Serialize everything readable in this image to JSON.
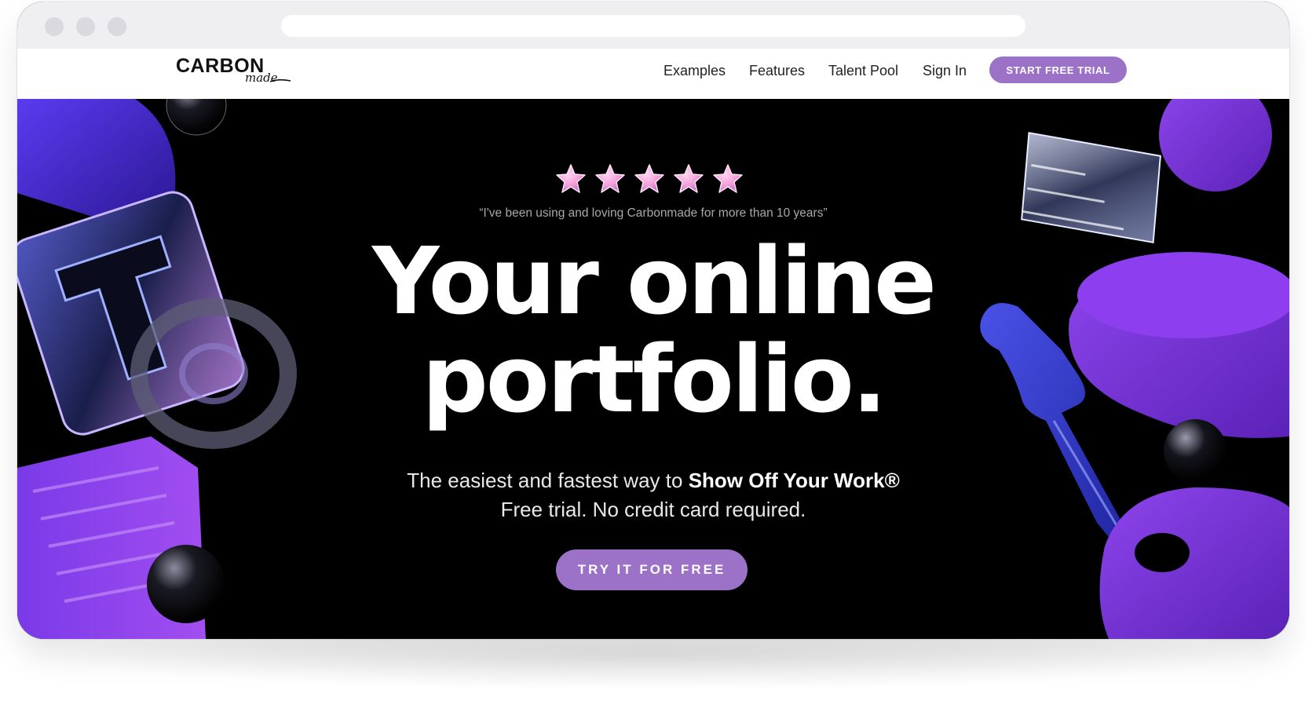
{
  "brand": {
    "logo_main": "CARBON",
    "logo_sub": "made"
  },
  "nav": {
    "links": [
      "Examples",
      "Features",
      "Talent Pool",
      "Sign In"
    ],
    "trial_button": "START FREE TRIAL"
  },
  "hero": {
    "rating": {
      "value": 5,
      "max": 5
    },
    "quote": "“I've been using and loving Carbonmade for more than 10 years”",
    "headline_line1": "Your online",
    "headline_line2": "portfolio.",
    "sub_prefix": "The easiest and fastest way to",
    "sub_emphasis": "Show Off Your Work®",
    "sub_line2": "Free trial. No credit card required.",
    "cta_button": "TRY IT FOR FREE"
  },
  "colors": {
    "accent": "#9b72c8",
    "hero_background": "#000000",
    "chrome": "#efeff2"
  }
}
